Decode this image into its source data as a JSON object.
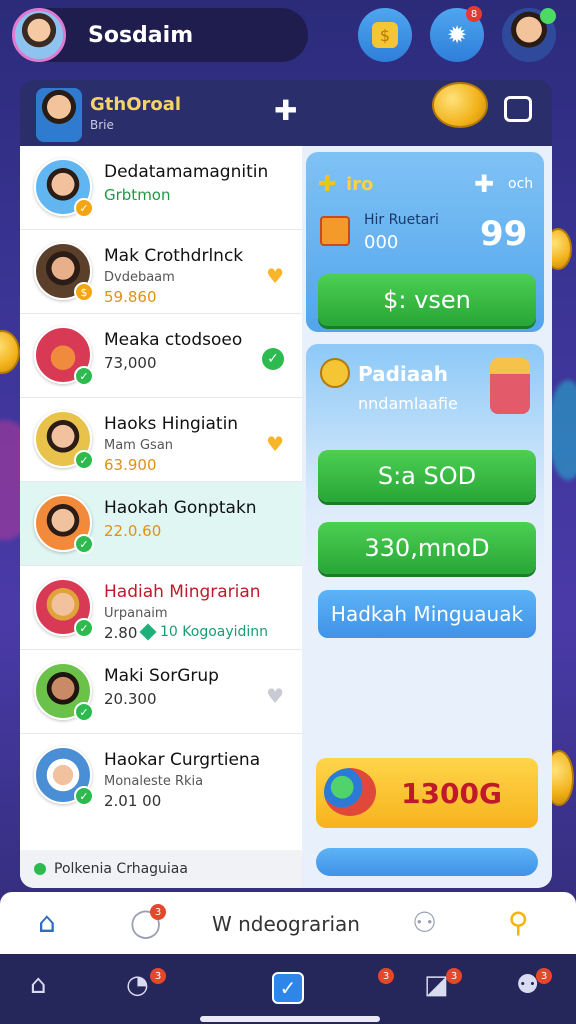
{
  "topbar": {
    "username": "Sosdaim",
    "badge_settings": "8"
  },
  "header": {
    "title": "GthOroal",
    "subtitle": "Brie"
  },
  "list": [
    {
      "title": "Dedatamamagnitin",
      "value": "Grbtmon",
      "value_color": "green",
      "icon": "none",
      "check": "gold",
      "active": false,
      "title_color": "dark"
    },
    {
      "title": "Mak Crothdrlnck",
      "subtitle": "Dvdebaam",
      "value": "59.860",
      "value_color": "gold",
      "icon": "heart-gold",
      "check": "gold",
      "active": false,
      "title_color": "dark"
    },
    {
      "title": "Meaka ctodsoeo",
      "value": "73,000",
      "value_color": "dark",
      "icon": "check-green",
      "check": "green",
      "active": false,
      "title_color": "dark"
    },
    {
      "title": "Haoks Hingiatin",
      "subtitle": "Mam Gsan",
      "value": "63.900",
      "value_color": "gold",
      "icon": "heart-gold",
      "check": "green",
      "active": false,
      "title_color": "dark"
    },
    {
      "title": "Haokah Gonptakn",
      "value": "22.0.60",
      "value_color": "gold",
      "icon": "none",
      "check": "green",
      "active": true,
      "title_color": "dark"
    },
    {
      "title": "Hadiah Mingrarian",
      "subtitle": "Urpanaim",
      "value": "2.80",
      "extra": "10 Kogoayidinn",
      "value_color": "dark",
      "icon": "none",
      "check": "green",
      "active": false,
      "title_color": "red"
    },
    {
      "title": "Maki SorGrup",
      "value": "20.300",
      "value_color": "dark",
      "icon": "heart-gray",
      "check": "green",
      "active": false,
      "title_color": "dark"
    },
    {
      "title": "Haokar Curgrtiena",
      "subtitle": "Monaleste Rkia",
      "value": "2.01 00",
      "value_color": "dark",
      "icon": "none",
      "check": "green",
      "active": false,
      "title_color": "dark"
    }
  ],
  "list_footer": "Polkenia Crhaguiaa",
  "right": {
    "card1_top_left": "iro",
    "card1_top_right": "och",
    "card1_label": "Hir Ruetari",
    "card1_small": "000",
    "card1_big": "99",
    "card1_button": "$: vsen",
    "card2_title": "Padiaah",
    "card2_subtitle": "nndamlaafie",
    "button_green_1": "S:a SOD",
    "button_green_2": "330,mnoD",
    "button_blue": "Hadkah Minguauak",
    "banner_value": "1300G"
  },
  "bottom_nav": {
    "label": "W ndeograrian",
    "badge_chat": "3"
  },
  "system_bar": {
    "badge_1": "3",
    "badge_2": "3",
    "badge_3": "3",
    "badge_4": "3"
  },
  "colors": {
    "accent_green": "#2dbb4f",
    "accent_gold": "#f3a612",
    "accent_blue": "#3f92e8",
    "bg_dark": "#2a2f6b"
  }
}
